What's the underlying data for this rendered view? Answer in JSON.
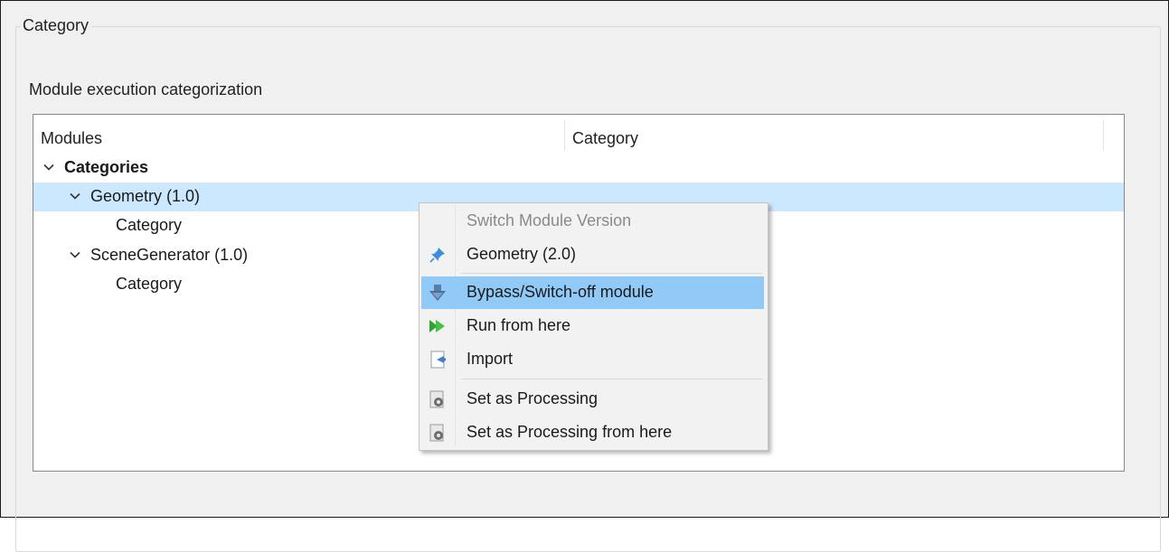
{
  "group": {
    "title": "Category"
  },
  "section": {
    "label": "Module execution categorization"
  },
  "tree": {
    "columns": [
      "Modules",
      "Category"
    ],
    "rows": [
      {
        "label": "Categories",
        "expanded": true,
        "bold": true
      },
      {
        "label": "Geometry (1.0)",
        "expanded": true,
        "selected": true
      },
      {
        "label": "Category"
      },
      {
        "label": "SceneGenerator (1.0)",
        "expanded": true
      },
      {
        "label": "Category"
      }
    ]
  },
  "context_menu": {
    "items": [
      {
        "label": "Switch Module Version",
        "disabled": true,
        "icon": "none"
      },
      {
        "label": "Geometry (2.0)",
        "icon": "pin-icon"
      },
      {
        "label": "Bypass/Switch-off module",
        "icon": "bypass-arrow-icon",
        "highlighted": true
      },
      {
        "label": "Run from here",
        "icon": "fast-forward-icon"
      },
      {
        "label": "Import",
        "icon": "import-icon"
      },
      {
        "label": "Set as Processing",
        "icon": "processing-gear-icon"
      },
      {
        "label": "Set as Processing from here",
        "icon": "processing-gear-icon"
      }
    ]
  },
  "colors": {
    "selection": "#cce8ff",
    "menu_highlight": "#91c9f7",
    "window_bg": "#f0f0f0"
  }
}
